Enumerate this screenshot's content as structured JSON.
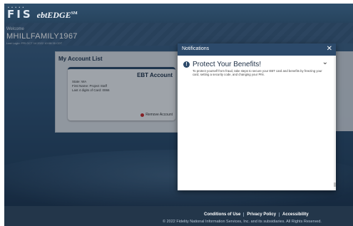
{
  "header": {
    "brand_fis": "FIS",
    "brand_ebt": "ebtEDGE",
    "brand_tm": "SM",
    "welcome": "Welcome",
    "username": "MHILLFAMILY1967",
    "last_login": "Last Login: FRI OCT 14 2022 10:08:35 CDT"
  },
  "account_list": {
    "title": "My Account List",
    "card": {
      "title": "EBT Account",
      "state": "State: WA",
      "first_name": "First Name: Project Staff",
      "last4": "Last 4 digits of Card: 0066",
      "remove_label": "Remove Account"
    }
  },
  "modal": {
    "title": "Notifications",
    "close": "✕",
    "alert_icon": "!",
    "alert_title": "Protect Your Benefits!",
    "alert_body": "To protect yourself from fraud, take steps to secure your EBT card and benefits by freezing your card, setting a security code, and changing your PIN.",
    "chevron": "⌄"
  },
  "footer": {
    "links": [
      "Conditions of Use",
      "Privacy Policy",
      "Accessibility"
    ],
    "copyright": "© 2022 Fidelity National Information Services, Inc. and its subsidiaries. All Rights Reserved."
  },
  "colors": {
    "header_bg": "#2f4f6c",
    "modal_header": "#2c4a6b",
    "remove_dot": "#c62828"
  },
  "icons": {
    "close": "close-icon",
    "alert": "info-alert-icon",
    "chevron": "chevron-down-icon",
    "remove": "remove-dot-icon"
  }
}
